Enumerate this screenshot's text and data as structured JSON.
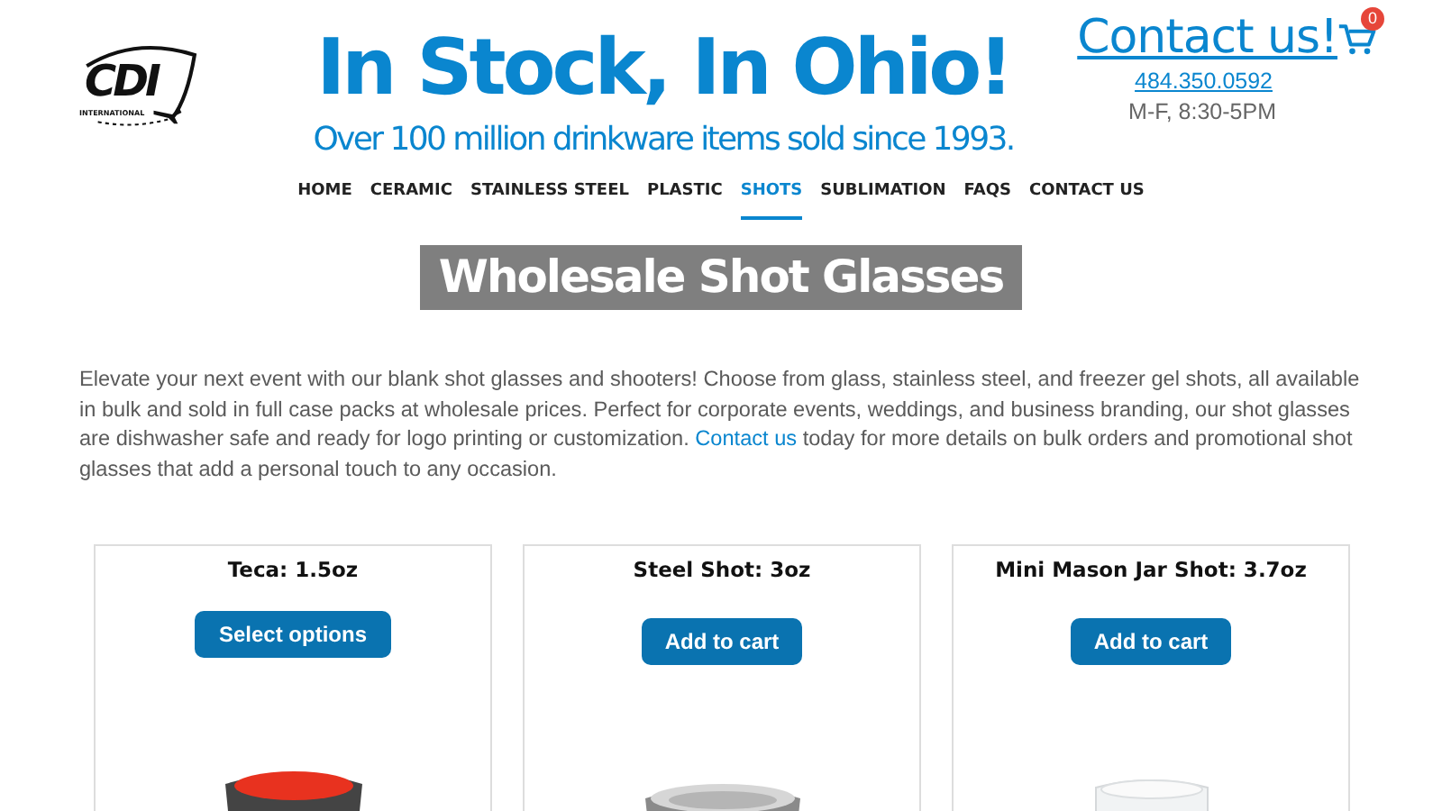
{
  "logo": {
    "mark": "CDI",
    "subtitle": "INTERNATIONAL"
  },
  "header": {
    "title": "In Stock, In Ohio!",
    "tagline": "Over 100 million drinkware items sold since 1993.",
    "contact_link": "Contact us!",
    "phone": "484.350.0592",
    "hours": "M-F, 8:30-5PM",
    "cart_count": "0"
  },
  "nav": [
    {
      "label": "HOME",
      "selected": false
    },
    {
      "label": "CERAMIC",
      "selected": false
    },
    {
      "label": "STAINLESS STEEL",
      "selected": false
    },
    {
      "label": "PLASTIC",
      "selected": false
    },
    {
      "label": "SHOTS",
      "selected": true
    },
    {
      "label": "SUBLIMATION",
      "selected": false
    },
    {
      "label": "FAQS",
      "selected": false
    },
    {
      "label": "CONTACT US",
      "selected": false
    }
  ],
  "page_title": "Wholesale Shot Glasses",
  "intro": [
    {
      "kind": "text",
      "text": "Elevate your next event with our blank shot glasses and shooters! Choose from glass, stainless steel, and freezer gel shots, all available in bulk and sold in full case packs at wholesale prices. Perfect for corporate events, weddings, and business branding, our shot glasses are dishwasher safe and ready for logo printing or customization."
    },
    {
      "kind": "link",
      "text": "Contact us"
    },
    {
      "kind": "text",
      "text": "today for more details on bulk orders and promotional shot glasses that add a personal touch to any occasion."
    }
  ],
  "products": [
    {
      "name": "Teca: 1.5oz",
      "button": "Select options",
      "kind": "ceramic"
    },
    {
      "name": "Steel Shot: 3oz",
      "button": "Add to cart",
      "kind": "steel"
    },
    {
      "name": "Mini Mason Jar Shot: 3.7oz",
      "button": "Add to cart",
      "kind": "glass"
    }
  ]
}
